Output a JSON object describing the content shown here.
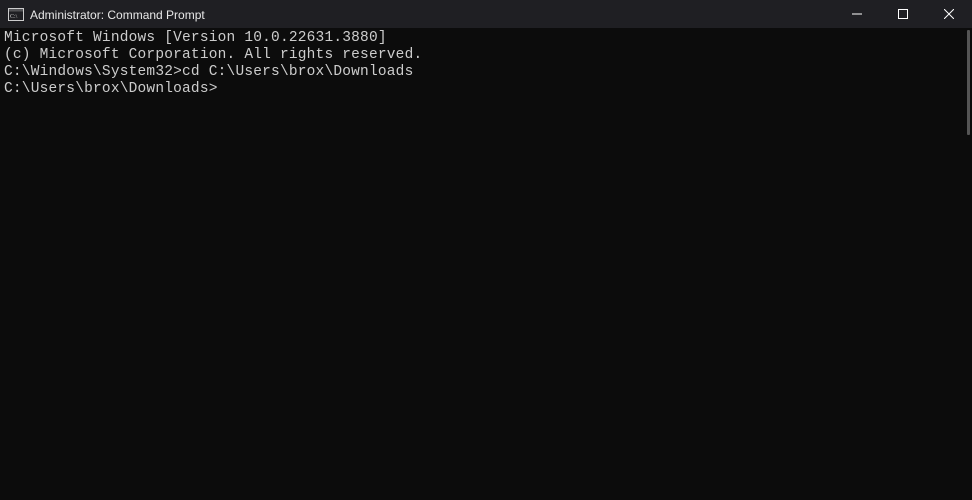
{
  "window": {
    "title": "Administrator: Command Prompt"
  },
  "terminal": {
    "line1": "Microsoft Windows [Version 10.0.22631.3880]",
    "line2": "(c) Microsoft Corporation. All rights reserved.",
    "blank1": "",
    "prompt1": "C:\\Windows\\System32>",
    "command1": "cd C:\\Users\\brox\\Downloads",
    "blank2": "",
    "prompt2": "C:\\Users\\brox\\Downloads>"
  }
}
